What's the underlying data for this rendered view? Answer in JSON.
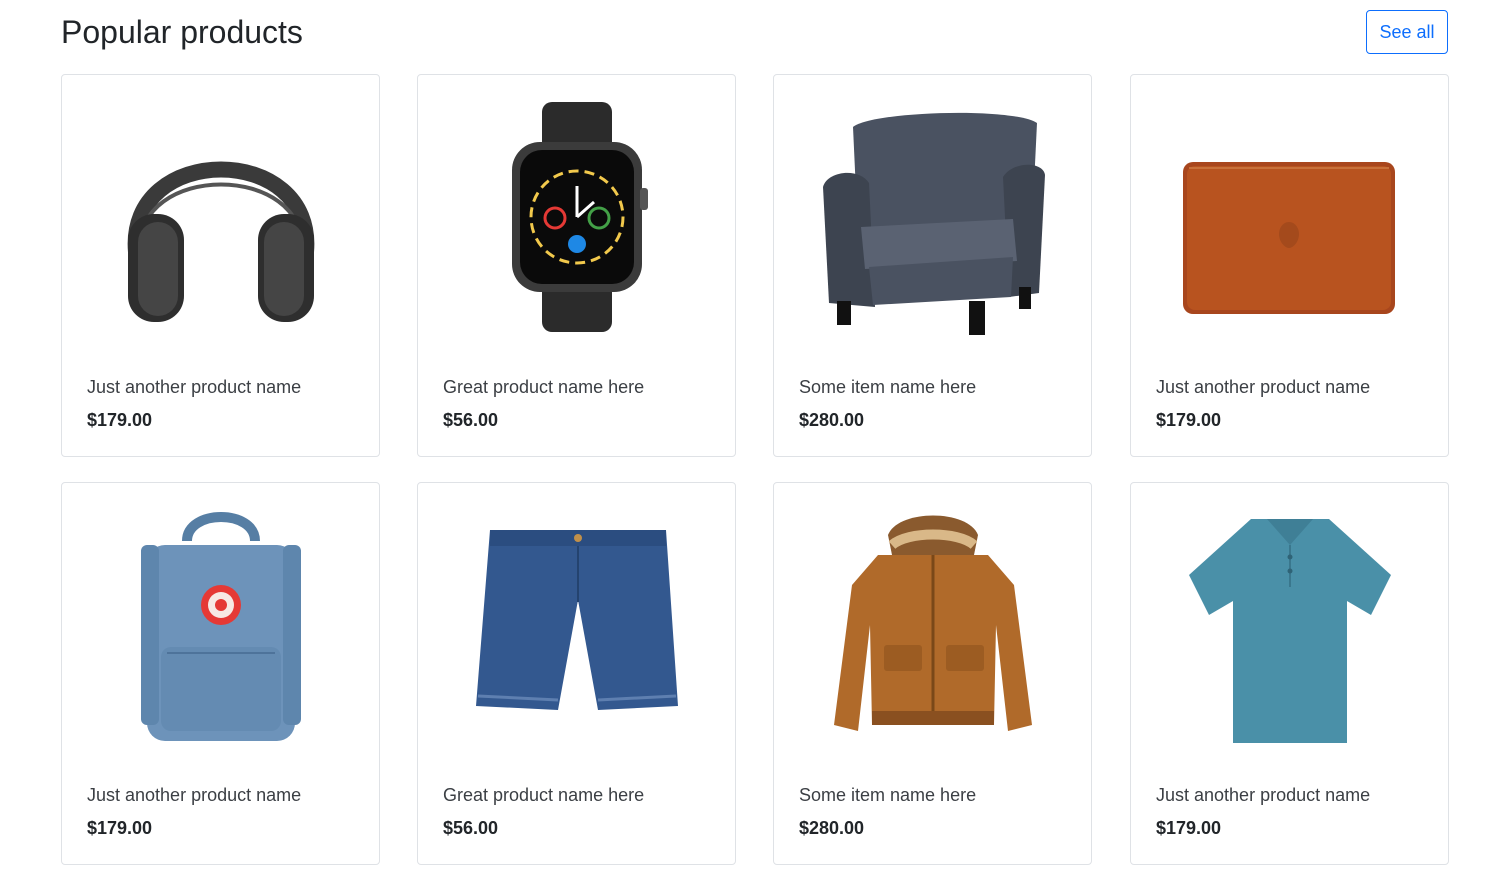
{
  "header": {
    "title": "Popular products",
    "see_all_label": "See all"
  },
  "products": [
    {
      "name": "Just another product name",
      "price": "$179.00",
      "image": "headphones"
    },
    {
      "name": "Great product name here",
      "price": "$56.00",
      "image": "smartwatch"
    },
    {
      "name": "Some item name here",
      "price": "$280.00",
      "image": "armchair"
    },
    {
      "name": "Just another product name",
      "price": "$179.00",
      "image": "laptop-sleeve"
    },
    {
      "name": "Just another product name",
      "price": "$179.00",
      "image": "backpack"
    },
    {
      "name": "Great product name here",
      "price": "$56.00",
      "image": "denim-shorts"
    },
    {
      "name": "Some item name here",
      "price": "$280.00",
      "image": "winter-jacket"
    },
    {
      "name": "Just another product name",
      "price": "$179.00",
      "image": "polo-shirt"
    }
  ],
  "colors": {
    "accent": "#0d6efd",
    "border": "#dfe2e6",
    "text": "#212529"
  }
}
